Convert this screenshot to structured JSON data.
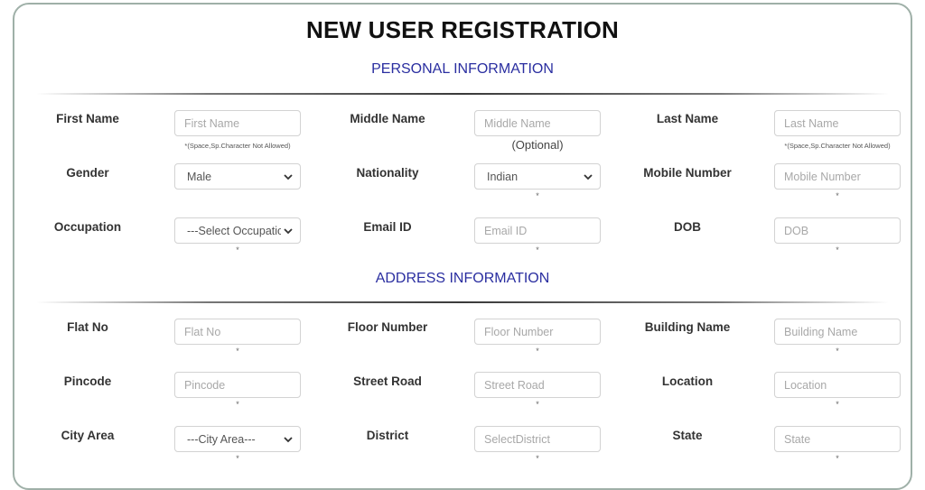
{
  "page": {
    "title": "NEW USER REGISTRATION",
    "personal_section": "PERSONAL INFORMATION",
    "address_section": "ADDRESS INFORMATION"
  },
  "required_mark": "*",
  "personal": {
    "first_name": {
      "label": "First Name",
      "placeholder": "First Name",
      "note": "*(Space,Sp.Character Not Allowed)"
    },
    "middle_name": {
      "label": "Middle Name",
      "placeholder": "Middle Name",
      "note": "(Optional)"
    },
    "last_name": {
      "label": "Last Name",
      "placeholder": "Last Name",
      "note": "*(Space,Sp.Character Not Allowed)"
    },
    "gender": {
      "label": "Gender",
      "selected": "Male"
    },
    "nationality": {
      "label": "Nationality",
      "selected": "Indian"
    },
    "mobile": {
      "label": "Mobile Number",
      "placeholder": "Mobile Number"
    },
    "occupation": {
      "label": "Occupation",
      "selected": "---Select Occupation---"
    },
    "email": {
      "label": "Email ID",
      "placeholder": "Email ID"
    },
    "dob": {
      "label": "DOB",
      "placeholder": "DOB"
    }
  },
  "address": {
    "flat_no": {
      "label": "Flat No",
      "placeholder": "Flat No"
    },
    "floor_number": {
      "label": "Floor Number",
      "placeholder": "Floor Number"
    },
    "building_name": {
      "label": "Building Name",
      "placeholder": "Building Name"
    },
    "pincode": {
      "label": "Pincode",
      "placeholder": "Pincode"
    },
    "street_road": {
      "label": "Street Road",
      "placeholder": "Street Road"
    },
    "location": {
      "label": "Location",
      "placeholder": "Location"
    },
    "city_area": {
      "label": "City Area",
      "selected": "---City Area---"
    },
    "district": {
      "label": "District",
      "placeholder": "SelectDistrict"
    },
    "state": {
      "label": "State",
      "placeholder": "State"
    }
  },
  "colors": {
    "section_title": "#2a2ea0",
    "card_border": "#9fb0a8"
  }
}
